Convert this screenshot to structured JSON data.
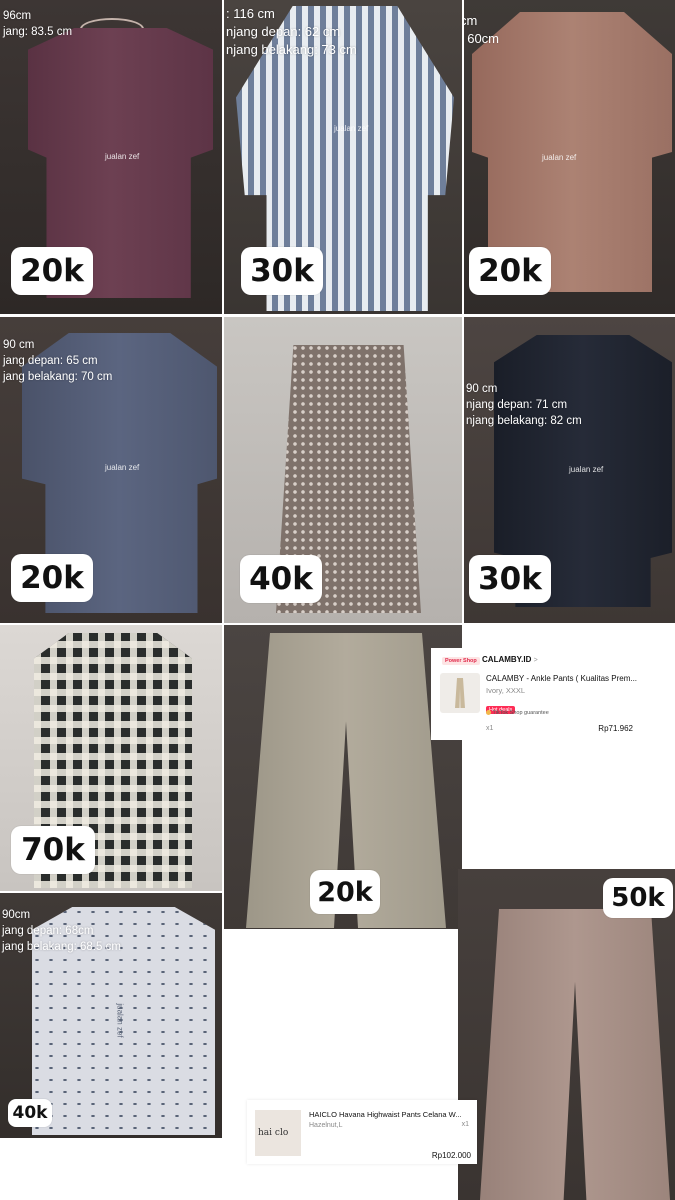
{
  "items": [
    {
      "price": "20k",
      "measurements": [
        "96cm",
        "jang: 83.5 cm"
      ],
      "watermark": "jualan zef"
    },
    {
      "price": "30k",
      "measurements": [
        ": 116 cm",
        "njang depan: 62 cm",
        "njang belakang: 73 cm"
      ],
      "watermark": "jualan zef"
    },
    {
      "price": "20k",
      "measurements": [
        "cm",
        ": 60cm"
      ],
      "watermark": "jualan zef"
    },
    {
      "price": "20k",
      "measurements": [
        "90 cm",
        "jang depan: 65 cm",
        "jang belakang: 70 cm"
      ],
      "watermark": "jualan zef"
    },
    {
      "price": "40k",
      "measurements": [],
      "watermark": ""
    },
    {
      "price": "30k",
      "measurements": [
        "90 cm",
        "njang depan: 71 cm",
        "njang belakang: 82 cm"
      ],
      "watermark": "jualan zef"
    },
    {
      "price": "70k",
      "measurements": [],
      "watermark": ""
    },
    {
      "price": "20k",
      "measurements": [],
      "watermark": ""
    },
    {
      "price": "40k",
      "measurements": [
        "90cm",
        "jang depan: 68cm",
        "jang belakang: 68.5 cm"
      ],
      "watermark": "jualan zef"
    },
    {
      "price": "50k",
      "measurements": [],
      "watermark": ""
    }
  ],
  "order_card_1": {
    "shop_badge": "Power Shop",
    "shop_name": "CALAMBY.ID",
    "shop_chevron": ">",
    "product_title": "CALAMBY - Ankle Pants ( Kualitas Prem...",
    "variant": "Ivory, XXXL",
    "hot_badge": "Hot deals",
    "guarantee": "TikTok Shop guarantee",
    "quantity": "x1",
    "price": "Rp71.962"
  },
  "order_card_2": {
    "thumb_text": "hai clo",
    "product_title": "HAICLO Havana Highwaist Pants Celana W...",
    "variant": "Hazelnut,L",
    "quantity": "x1",
    "price": "Rp102.000"
  },
  "colors": {
    "shirt_plum": "#6a3e50",
    "stripe_blue": "#7b8aa5",
    "shirt_rose": "#a87e70",
    "shirt_slate": "#566078",
    "skirt_floral": "#8d8079",
    "shirt_black": "#1f2430",
    "plaid_dark": "#2a2d2c",
    "pants_khaki": "#a9a293",
    "blouse_white": "#d9dbe2",
    "pants_taupe": "#a58e85",
    "tiktok_red": "#fe2c55"
  }
}
